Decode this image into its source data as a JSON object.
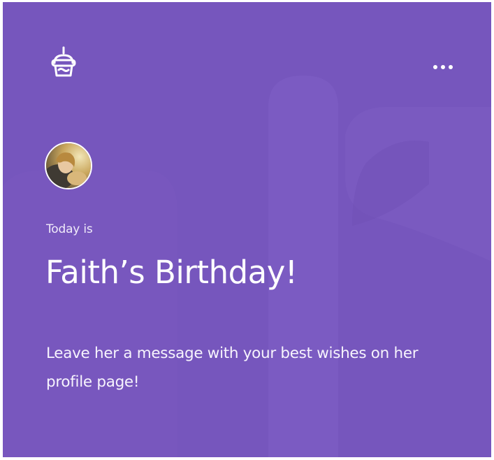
{
  "colors": {
    "card_background": "#7656bd",
    "shape_light": "#7f5fc4",
    "shape_dark": "#6e4fb5",
    "text": "#ffffff"
  },
  "header": {
    "icon": "birthday-cake-icon",
    "menu_icon": "more-options-icon"
  },
  "person": {
    "avatar": "profile-photo"
  },
  "content": {
    "eyebrow": "Today is",
    "title": "Faith’s Birthday!",
    "message": "Leave her a message with your best wishes on her profile page!"
  }
}
